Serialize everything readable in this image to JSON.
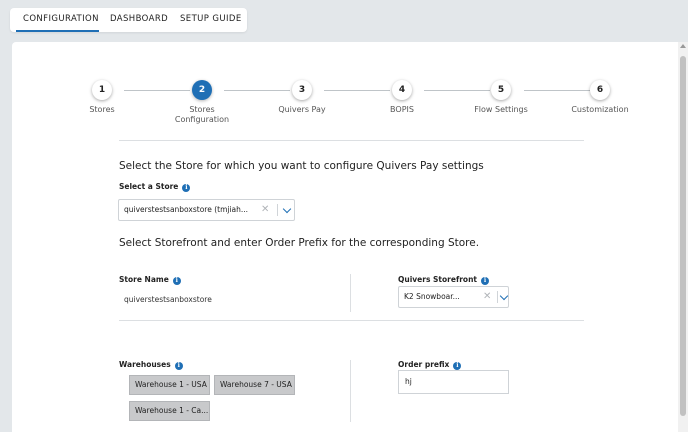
{
  "topnav": {
    "tabs": [
      {
        "label": "CONFIGURATION",
        "active": true
      },
      {
        "label": "DASHBOARD",
        "active": false
      },
      {
        "label": "SETUP GUIDE",
        "active": false
      }
    ]
  },
  "stepper": {
    "steps": [
      {
        "number": "1",
        "label": "Stores"
      },
      {
        "number": "2",
        "label": "Stores Configuration",
        "active": true
      },
      {
        "number": "3",
        "label": "Quivers Pay"
      },
      {
        "number": "4",
        "label": "BOPIS"
      },
      {
        "number": "5",
        "label": "Flow Settings"
      },
      {
        "number": "6",
        "label": "Customization"
      }
    ]
  },
  "store_section": {
    "heading": "Select the Store for which you want to configure Quivers Pay settings",
    "select_label": "Select a Store",
    "select_value": "quiverstestsanboxstore (tmjiah..."
  },
  "storefront_section": {
    "heading": "Select Storefront and enter Order Prefix for the corresponding Store.",
    "store_name_label": "Store Name",
    "store_name_value": "quiverstestsanboxstore",
    "storefront_label": "Quivers Storefront",
    "storefront_value": "K2 Snowboar..."
  },
  "warehouse_section": {
    "label": "Warehouses",
    "chips": [
      "Warehouse 1 - USA",
      "Warehouse 7 - USA",
      "Warehouse 1 - Ca..."
    ],
    "order_prefix_label": "Order prefix",
    "order_prefix_value": "hj"
  },
  "icons": {
    "info": "i",
    "clear": "✕"
  },
  "colors": {
    "accent": "#1f6fb5",
    "chip_bg": "#c8c9cb",
    "background": "#e3e7ea"
  }
}
